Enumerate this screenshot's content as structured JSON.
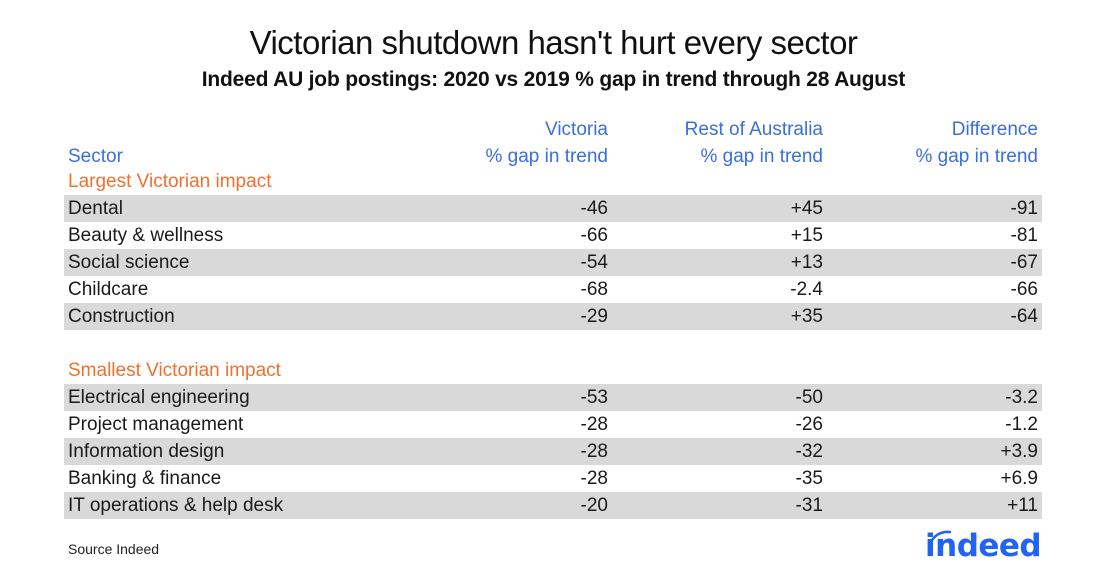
{
  "chart_data": {
    "type": "table",
    "title": "Victorian shutdown hasn't hurt every sector",
    "subtitle": "Indeed AU job postings: 2020 vs 2019 % gap in trend through 28 August",
    "columns": [
      {
        "key": "sector",
        "label_line1": "",
        "label_line2": "Sector"
      },
      {
        "key": "victoria",
        "label_line1": "Victoria",
        "label_line2": "% gap in trend"
      },
      {
        "key": "rest",
        "label_line1": "Rest of Australia",
        "label_line2": "% gap in trend"
      },
      {
        "key": "diff",
        "label_line1": "Difference",
        "label_line2": "% gap in trend"
      }
    ],
    "groups": [
      {
        "label": "Largest Victorian impact",
        "rows": [
          {
            "sector": "Dental",
            "victoria": "-46",
            "rest": "+45",
            "diff": "-91"
          },
          {
            "sector": "Beauty & wellness",
            "victoria": "-66",
            "rest": "+15",
            "diff": "-81"
          },
          {
            "sector": "Social science",
            "victoria": "-54",
            "rest": "+13",
            "diff": "-67"
          },
          {
            "sector": "Childcare",
            "victoria": "-68",
            "rest": "-2.4",
            "diff": "-66"
          },
          {
            "sector": "Construction",
            "victoria": "-29",
            "rest": "+35",
            "diff": "-64"
          }
        ]
      },
      {
        "label": "Smallest Victorian impact",
        "rows": [
          {
            "sector": "Electrical engineering",
            "victoria": "-53",
            "rest": "-50",
            "diff": "-3.2"
          },
          {
            "sector": "Project management",
            "victoria": "-28",
            "rest": "-26",
            "diff": "-1.2"
          },
          {
            "sector": "Information design",
            "victoria": "-28",
            "rest": "-32",
            "diff": "+3.9"
          },
          {
            "sector": "Banking & finance",
            "victoria": "-28",
            "rest": "-35",
            "diff": "+6.9"
          },
          {
            "sector": "IT operations & help desk",
            "victoria": "-20",
            "rest": "-31",
            "diff": "+11"
          }
        ]
      }
    ]
  },
  "footer": {
    "source": "Source Indeed",
    "logo_text": "indeed"
  },
  "colors": {
    "header_blue": "#3b6fd8",
    "group_orange": "#f07030",
    "row_shade": "#d9d9d9",
    "logo_blue": "#2164f3"
  }
}
